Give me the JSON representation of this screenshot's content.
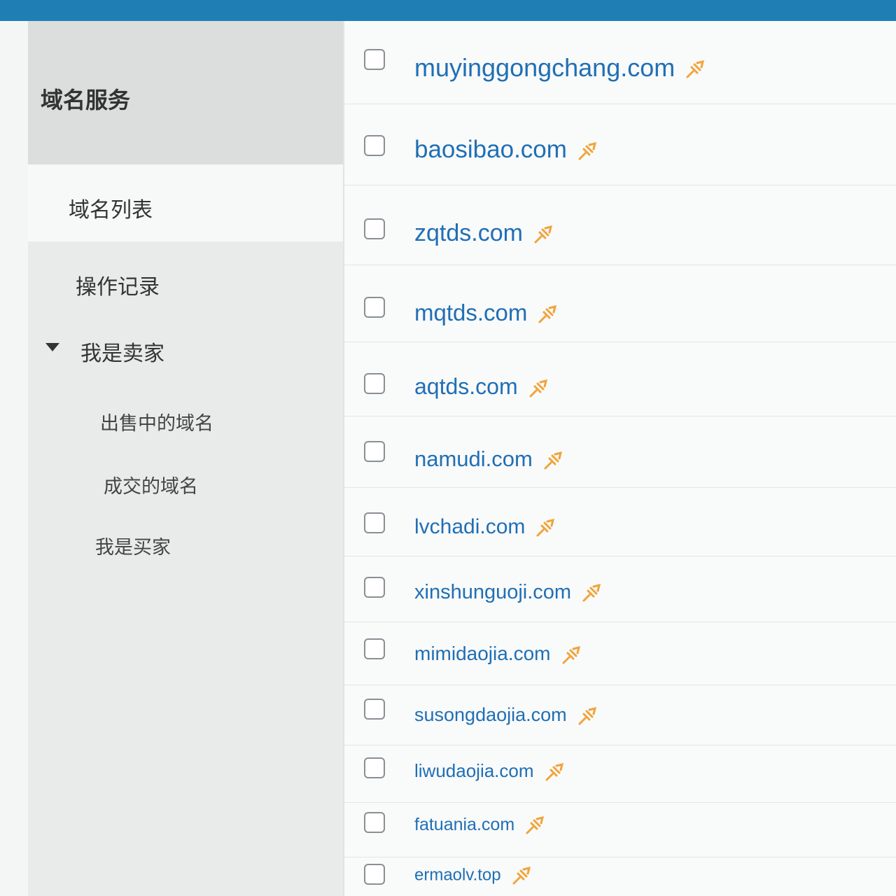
{
  "sidebar": {
    "title": "域名服务",
    "items": [
      {
        "label": "域名列表",
        "active": true
      },
      {
        "label": "操作记录",
        "active": false
      },
      {
        "label": "我是卖家",
        "expanded": true
      },
      {
        "label": "出售中的域名",
        "sub": true
      },
      {
        "label": "成交的域名",
        "sub": true
      },
      {
        "label": "我是买家",
        "sub": true
      }
    ]
  },
  "domains": [
    "muyinggongchang.com",
    "baosibao.com",
    "zqtds.com",
    "mqtds.com",
    "aqtds.com",
    "namudi.com",
    "lvchadi.com",
    "xinshunguoji.com",
    "mimidaojia.com",
    "susongdaojia.com",
    "liwudaojia.com",
    "fatuania.com",
    "ermaolv.top"
  ],
  "icons": {
    "strip": "gear-icon",
    "domain_marker": "pin-icon",
    "expand": "caret-down-icon"
  },
  "colors": {
    "accent": "#1f7fb5",
    "link": "#1f6fb5",
    "pin": "#f0a43a"
  }
}
